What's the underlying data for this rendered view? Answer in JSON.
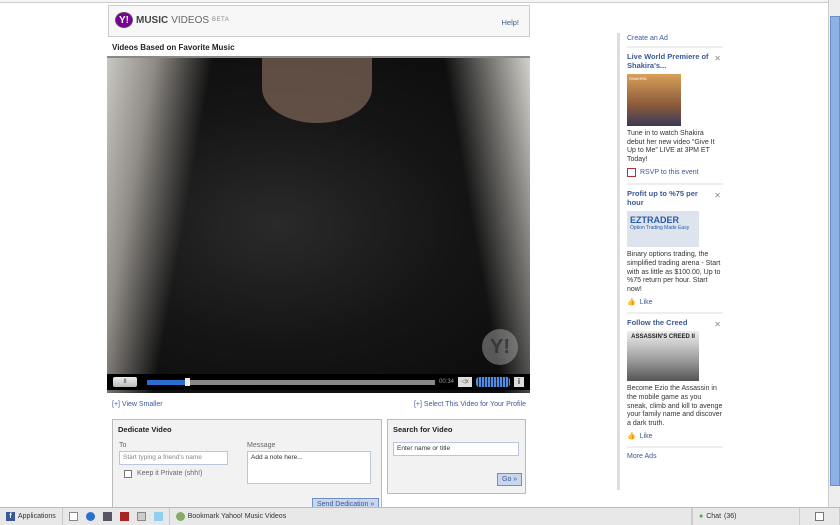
{
  "header": {
    "logo_y": "Y!",
    "logo_music": "MUSIC",
    "logo_videos": "VIDEOS",
    "logo_beta": "BETA",
    "help": "Help!"
  },
  "page_title": "Videos Based on Favorite Music",
  "player": {
    "watermark": "Y!",
    "time": "00:34",
    "progress": 0.14,
    "volume": 0.6,
    "pause_icon": "II",
    "mute_icon": "◁x",
    "info_icon": "i"
  },
  "links": {
    "view_smaller": "[+] View Smaller",
    "select_profile": "[+] Select This Video for Your Profile"
  },
  "dedicate": {
    "title": "Dedicate Video",
    "to_label": "To",
    "to_placeholder": "Start typing a friend's name",
    "private_label": "Keep it Private (shh!)",
    "message_label": "Message",
    "message_placeholder": "Add a note here...",
    "send": "Send Dedication »"
  },
  "search": {
    "title": "Search for Video",
    "placeholder": "Enter name or title",
    "go": "Go »"
  },
  "sidebar": {
    "create_ad": "Create an Ad",
    "more_ads": "More Ads",
    "ads": [
      {
        "title": "Live World Premiere of Shakira's...",
        "body": "Tune in to watch Shakira debut her new video “Give It Up to Me” LIVE at 3PM ET Today!",
        "action": "RSVP to this event",
        "image_text": "SHAKIRA"
      },
      {
        "title": "Profit up to %75 per hour",
        "body": "Binary options trading, the simplified trading arena - Start with as little as $100.00, Up to %75 return per hour. Start now!",
        "action": "Like",
        "image_text": "EZTRADER",
        "image_sub": "Option Trading Made Easy"
      },
      {
        "title": "Follow the Creed",
        "body": "Become Ezio the Assassin in the mobile game as you sneak, climb and kill to avenge your family name and discover a dark truth.",
        "action": "Like",
        "image_text": "ASSASSIN'S CREED II"
      }
    ]
  },
  "taskbar": {
    "applications": "Applications",
    "bookmark": "Bookmark Yahoo! Music Videos",
    "chat": "Chat",
    "chat_count": "(36)"
  }
}
